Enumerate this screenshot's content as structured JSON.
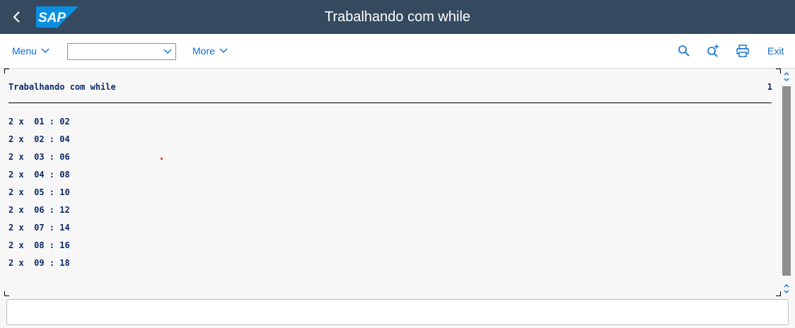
{
  "header": {
    "title": "Trabalhando com while",
    "logo_text": "SAP",
    "colors": {
      "shell_bg": "#354a5f",
      "logo_blue": "#0a8fe0"
    }
  },
  "toolbar": {
    "menu_label": "Menu",
    "select_value": "",
    "more_label": "More",
    "exit_label": "Exit",
    "icons": [
      "search-icon",
      "search-plus-icon",
      "print-icon"
    ]
  },
  "list": {
    "title": "Trabalhando com while",
    "page_number": "1",
    "rows": [
      "2 x  01 : 02",
      "2 x  02 : 04",
      "2 x  03 : 06",
      "2 x  04 : 08",
      "2 x  05 : 10",
      "2 x  06 : 12",
      "2 x  07 : 14",
      "2 x  08 : 16",
      "2 x  09 : 18"
    ]
  },
  "command_field": {
    "value": ""
  }
}
